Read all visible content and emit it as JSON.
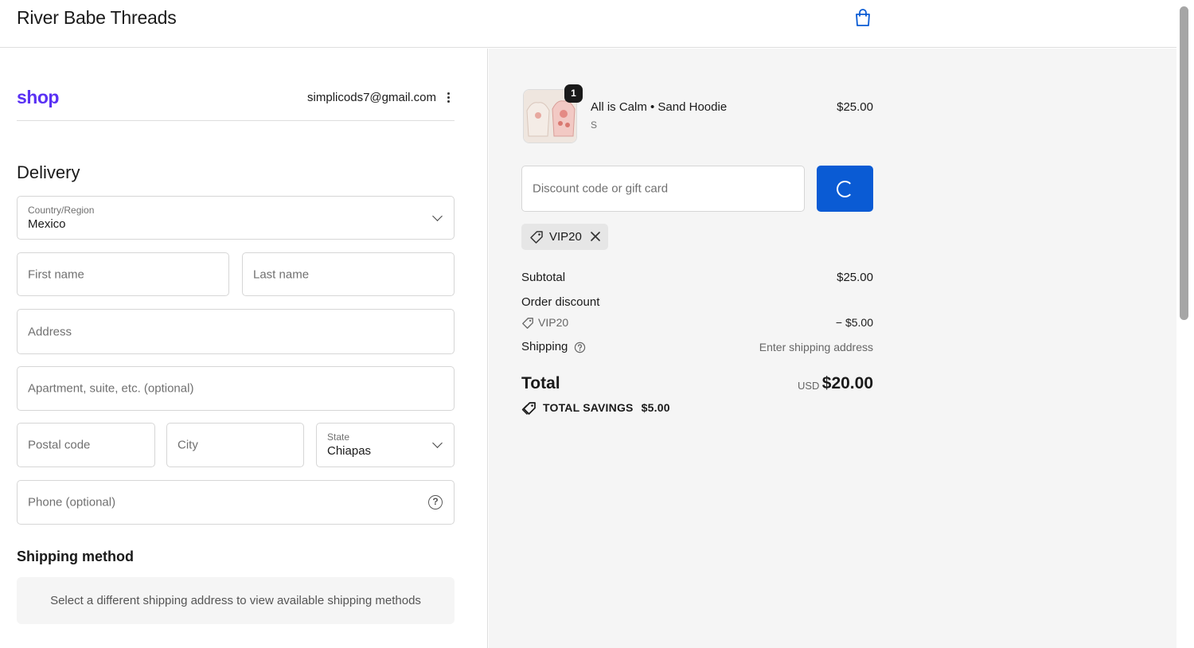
{
  "header": {
    "store_name": "River Babe Threads",
    "cart_icon": "shopping-bag-icon"
  },
  "account": {
    "shop_logo": "shop",
    "email": "simplicods7@gmail.com",
    "menu_icon": "kebab-menu-icon"
  },
  "delivery": {
    "title": "Delivery",
    "country": {
      "label": "Country/Region",
      "value": "Mexico"
    },
    "first_name": {
      "placeholder": "First name"
    },
    "last_name": {
      "placeholder": "Last name"
    },
    "address": {
      "placeholder": "Address"
    },
    "apartment": {
      "placeholder": "Apartment, suite, etc. (optional)"
    },
    "postal_code": {
      "placeholder": "Postal code"
    },
    "city": {
      "placeholder": "City"
    },
    "state": {
      "label": "State",
      "value": "Chiapas"
    },
    "phone": {
      "placeholder": "Phone (optional)",
      "help_icon": "?"
    }
  },
  "shipping_method": {
    "title": "Shipping method",
    "notice": "Select a different shipping address to view available shipping methods"
  },
  "order": {
    "item": {
      "quantity": "1",
      "name": "All is Calm • Sand Hoodie",
      "variant": "S",
      "price": "$25.00"
    },
    "discount": {
      "placeholder": "Discount code or gift card",
      "applied_code": "VIP20"
    },
    "summary": {
      "subtotal_label": "Subtotal",
      "subtotal_value": "$25.00",
      "order_discount_label": "Order discount",
      "discount_code": "VIP20",
      "discount_value": "− $5.00",
      "shipping_label": "Shipping",
      "shipping_value": "Enter shipping address",
      "total_label": "Total",
      "currency": "USD",
      "total_value": "$20.00",
      "savings_label": "TOTAL SAVINGS",
      "savings_value": "$5.00"
    }
  },
  "colors": {
    "accent": "#0a5bd4",
    "shop_brand": "#5a31f4",
    "panel_bg": "#f5f5f5"
  }
}
